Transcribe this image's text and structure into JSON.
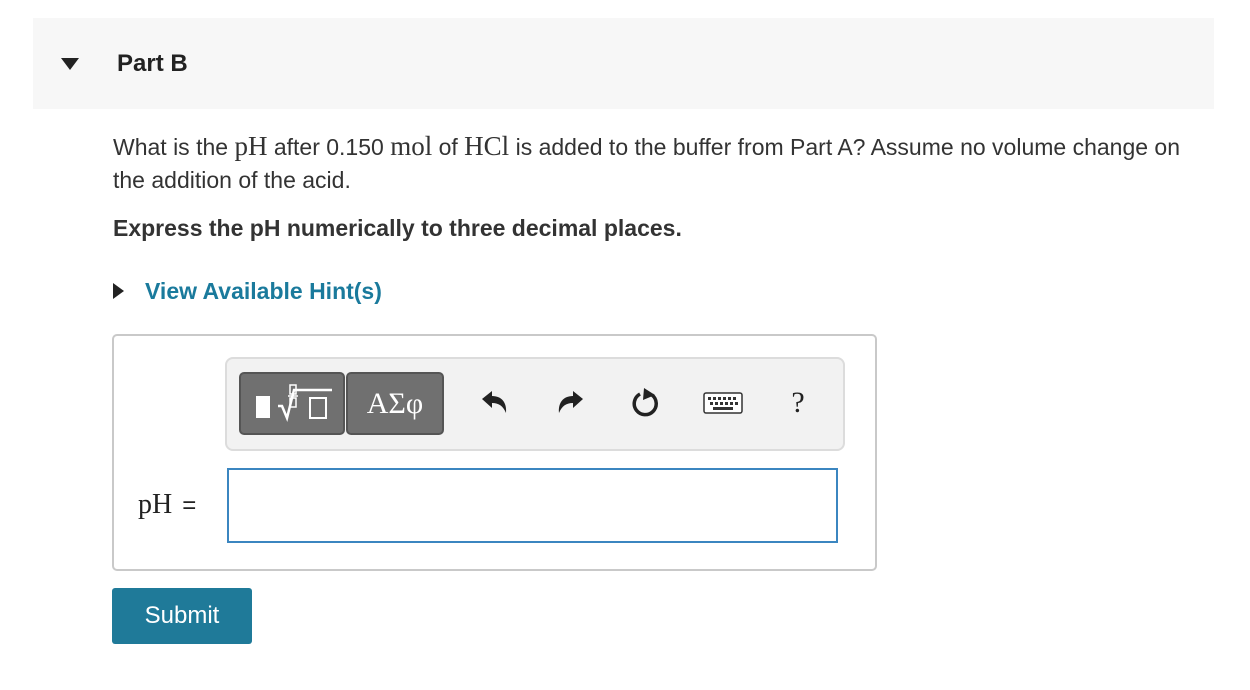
{
  "part": {
    "title": "Part B"
  },
  "question": {
    "text_1": "What is the ",
    "math_ph": "pH",
    "text_2": " after 0.150 ",
    "math_mol": "mol",
    "text_3": " of ",
    "math_hcl": "HCl",
    "text_4": " is added to the buffer from Part A? Assume no volume change on the addition of the acid."
  },
  "instruction": "Express the pH numerically to three decimal places.",
  "hints": {
    "label": "View Available Hint(s)"
  },
  "toolbar": {
    "greek_label": "ΑΣφ",
    "help_label": "?",
    "icons": [
      "templates-icon",
      "undo-icon",
      "redo-icon",
      "reset-icon",
      "keyboard-icon",
      "help-icon"
    ]
  },
  "answer": {
    "label": "pH",
    "equals": "=",
    "value": "",
    "placeholder": ""
  },
  "submit": {
    "label": "Submit"
  },
  "colors": {
    "accent": "#1a7a9c",
    "submit_bg": "#1f7a99",
    "input_border": "#3b86c0",
    "header_bg": "#f7f7f7"
  }
}
